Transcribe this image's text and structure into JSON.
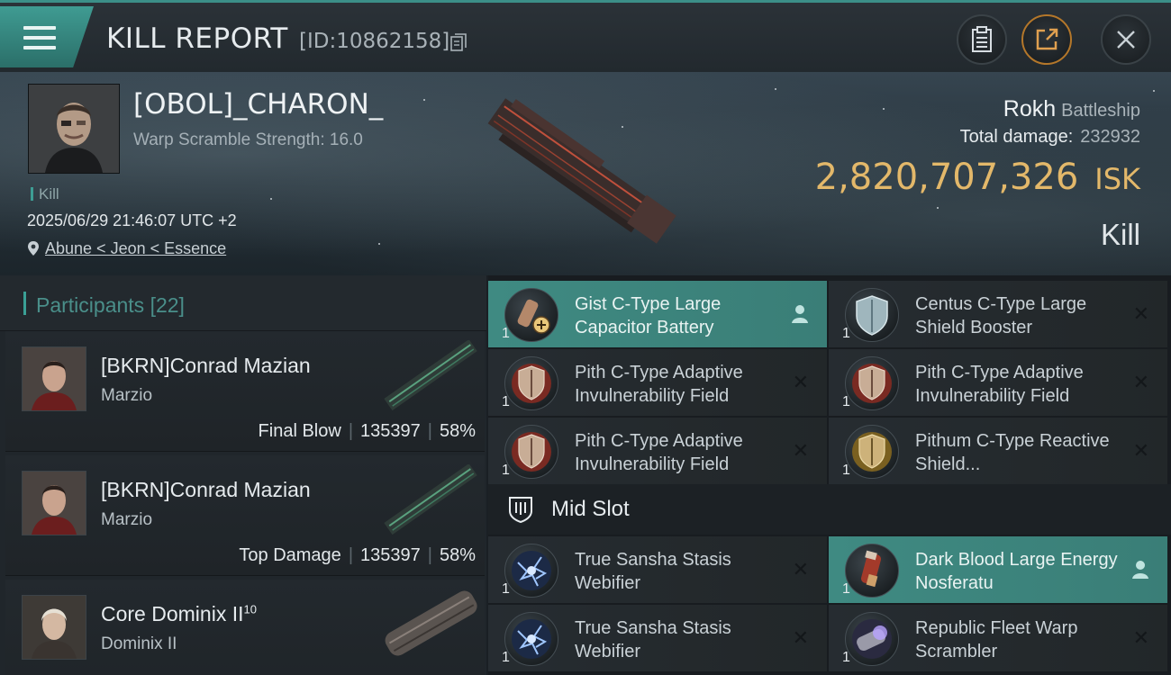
{
  "header": {
    "title": "KILL REPORT",
    "report_id": "[ID:10862158]",
    "menu_icon": "hamburger-menu-icon",
    "buttons": [
      "clipboard-icon",
      "share-icon",
      "close-icon"
    ]
  },
  "victim": {
    "name": "[OBOL]_CHARON_",
    "warp_scramble": "Warp Scramble Strength: 16.0",
    "tag": "Kill",
    "timestamp": "2025/06/29 21:46:07 UTC +2",
    "location": "Abune < Jeon < Essence",
    "ship": "Rokh",
    "ship_class": "Battleship",
    "total_damage_label": "Total damage:",
    "total_damage": "232932",
    "isk_value": "2,820,707,326",
    "isk_unit": "ISK",
    "result": "Kill"
  },
  "participants": {
    "label": "Participants",
    "count": "[22]",
    "items": [
      {
        "name": "[BKRN]Conrad Mazian",
        "ship": "Marzio",
        "role": "Final Blow",
        "damage": "135397",
        "percent": "58%"
      },
      {
        "name": "[BKRN]Conrad Mazian",
        "ship": "Marzio",
        "role": "Top Damage",
        "damage": "135397",
        "percent": "58%"
      },
      {
        "name": "Core Dominix II",
        "name_sup": "10",
        "ship": "Dominix II"
      }
    ]
  },
  "modules": {
    "high": [
      {
        "name": "Gist C-Type Large Capacitor Battery",
        "qty": "1",
        "highlight": true
      },
      {
        "name": "Centus C-Type Large Shield Booster",
        "qty": "1"
      },
      {
        "name": "Pith C-Type Adaptive Invulnerability Field",
        "qty": "1"
      },
      {
        "name": "Pith C-Type Adaptive Invulnerability Field",
        "qty": "1"
      },
      {
        "name": "Pith C-Type Adaptive Invulnerability Field",
        "qty": "1"
      },
      {
        "name": "Pithum C-Type Reactive Shield...",
        "qty": "1"
      }
    ],
    "mid_slot_label": "Mid Slot",
    "mid": [
      {
        "name": "True Sansha Stasis Webifier",
        "qty": "1"
      },
      {
        "name": "Dark Blood Large Energy Nosferatu",
        "qty": "1",
        "highlight": true
      },
      {
        "name": "True Sansha Stasis Webifier",
        "qty": "1"
      },
      {
        "name": "Republic Fleet Warp Scrambler",
        "qty": "1"
      }
    ]
  },
  "colors": {
    "accent": "#3f8a82",
    "isk": "#e3b86a",
    "background": "#1a1f24"
  }
}
